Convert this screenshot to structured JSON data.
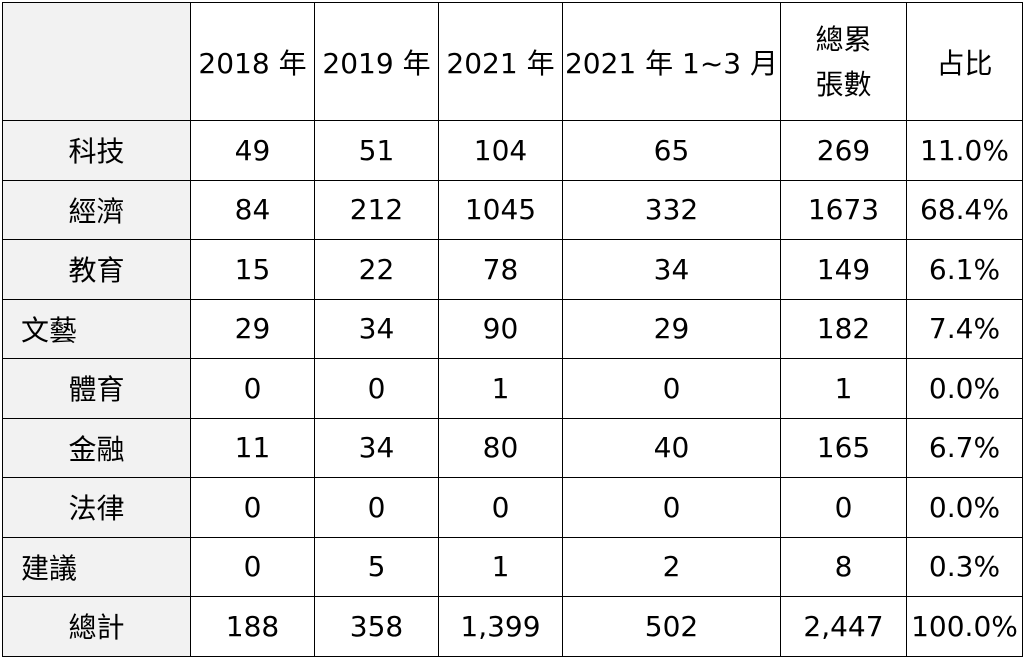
{
  "headers": {
    "col_2018": "2018 年",
    "col_2019": "2019 年",
    "col_2021": "2021 年",
    "col_2021_q1": "2021 年 1~3 月",
    "col_total_line1": "總累",
    "col_total_line2": "張數",
    "col_share": "占比"
  },
  "rows": [
    {
      "label": "科技",
      "y2018": "49",
      "y2019": "51",
      "y2021": "104",
      "q1": "65",
      "total": "269",
      "share": "11.0%"
    },
    {
      "label": "經濟",
      "y2018": "84",
      "y2019": "212",
      "y2021": "1045",
      "q1": "332",
      "total": "1673",
      "share": "68.4%"
    },
    {
      "label": "教育",
      "y2018": "15",
      "y2019": "22",
      "y2021": "78",
      "q1": "34",
      "total": "149",
      "share": "6.1%"
    },
    {
      "label": "文藝",
      "y2018": "29",
      "y2019": "34",
      "y2021": "90",
      "q1": "29",
      "total": "182",
      "share": "7.4%"
    },
    {
      "label": "體育",
      "y2018": "0",
      "y2019": "0",
      "y2021": "1",
      "q1": "0",
      "total": "1",
      "share": "0.0%"
    },
    {
      "label": "金融",
      "y2018": "11",
      "y2019": "34",
      "y2021": "80",
      "q1": "40",
      "total": "165",
      "share": "6.7%"
    },
    {
      "label": "法律",
      "y2018": "0",
      "y2019": "0",
      "y2021": "0",
      "q1": "0",
      "total": "0",
      "share": "0.0%"
    },
    {
      "label": "建議",
      "y2018": "0",
      "y2019": "5",
      "y2021": "1",
      "q1": "2",
      "total": "8",
      "share": "0.3%"
    },
    {
      "label": "總計",
      "y2018": "188",
      "y2019": "358",
      "y2021": "1,399",
      "q1": "502",
      "total": "2,447",
      "share": "100.0%"
    }
  ]
}
